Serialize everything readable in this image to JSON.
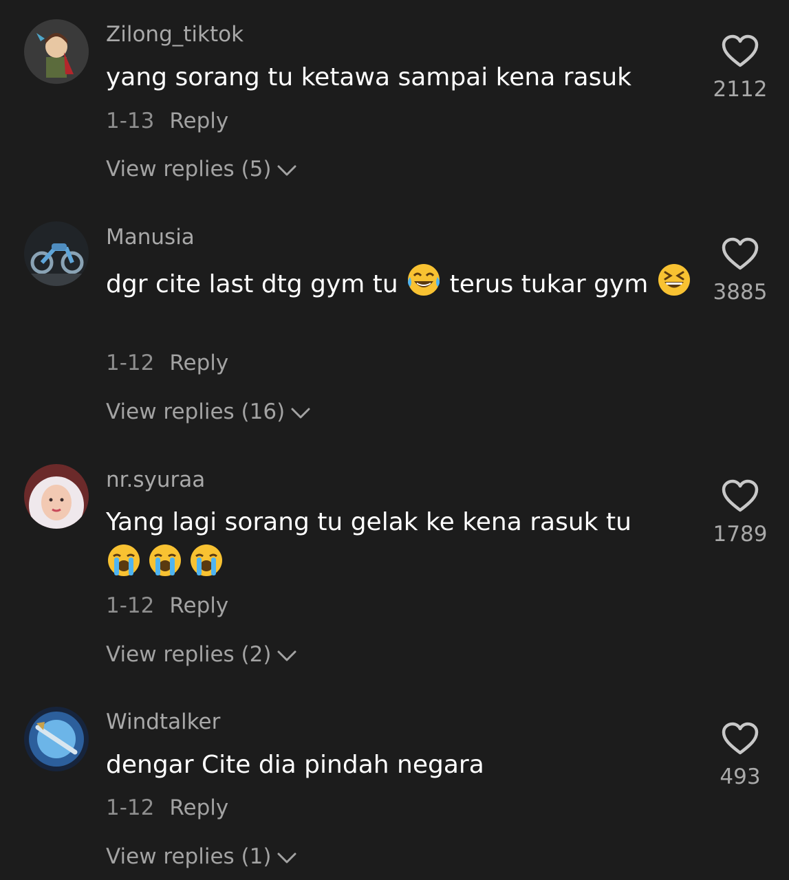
{
  "comments": [
    {
      "username": "Zilong_tiktok",
      "text": "yang sorang tu ketawa sampai kena rasuk",
      "emojis": [],
      "date": "1-13",
      "reply_label": "Reply",
      "view_replies": "View replies (5)",
      "likes": "2112",
      "avatar_icon": "anime-character-avatar"
    },
    {
      "username": "Manusia",
      "text_before": "dgr cite last dtg gym tu",
      "text_after": "terus tukar gym",
      "emojis": [
        "face-with-tears-of-joy",
        "grinning-squinting-face"
      ],
      "date": "1-12",
      "reply_label": "Reply",
      "view_replies": "View replies (16)",
      "likes": "3885",
      "avatar_icon": "motorcycle-avatar"
    },
    {
      "username": "nr.syuraa",
      "text": "Yang lagi sorang tu gelak ke kena rasuk tu",
      "emojis": [
        "loudly-crying-face",
        "loudly-crying-face",
        "loudly-crying-face"
      ],
      "date": "1-12",
      "reply_label": "Reply",
      "view_replies": "View replies (2)",
      "likes": "1789",
      "avatar_icon": "person-hijab-avatar"
    },
    {
      "username": "Windtalker",
      "text": "dengar Cite dia pindah negara",
      "emojis": [],
      "date": "1-12",
      "reply_label": "Reply",
      "view_replies": "View replies (1)",
      "likes": "493",
      "avatar_icon": "game-item-avatar"
    }
  ],
  "colors": {
    "background": "#1c1c1c",
    "primary_text": "#ffffff",
    "secondary_text": "#a9a9a9"
  }
}
